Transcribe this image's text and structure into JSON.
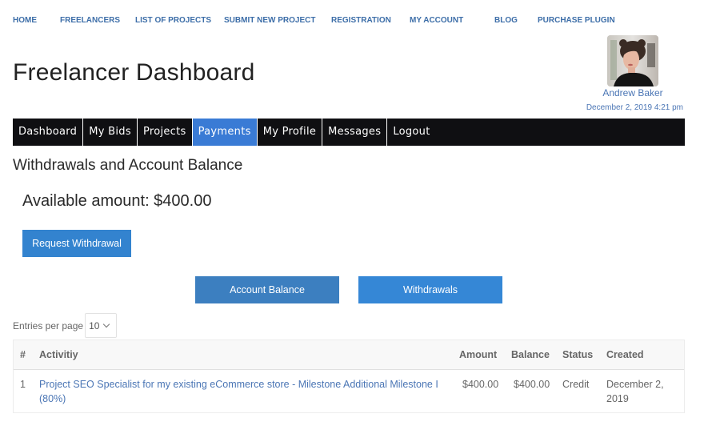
{
  "top_nav": [
    {
      "label": "HOME"
    },
    {
      "label": "FREELANCERS"
    },
    {
      "label": "LIST OF PROJECTS"
    },
    {
      "label": "SUBMIT NEW PROJECT"
    },
    {
      "label": "REGISTRATION"
    },
    {
      "label": "MY ACCOUNT"
    },
    {
      "label": "BLOG"
    },
    {
      "label": "PURCHASE PLUGIN"
    }
  ],
  "page_title": "Freelancer Dashboard",
  "user": {
    "name": "Andrew Baker",
    "datetime": "December 2, 2019 4:21 pm",
    "avatar_icon": "user-avatar-photo"
  },
  "tabs": [
    {
      "label": "Dashboard",
      "active": false
    },
    {
      "label": "My Bids",
      "active": false
    },
    {
      "label": "Projects",
      "active": false
    },
    {
      "label": "Payments",
      "active": true
    },
    {
      "label": "My Profile",
      "active": false
    },
    {
      "label": "Messages",
      "active": false
    },
    {
      "label": "Logout",
      "active": false
    }
  ],
  "section_title": "Withdrawals and Account Balance",
  "available_amount": "Available amount: $400.00",
  "buttons": {
    "request_withdrawal": "Request Withdrawal",
    "account_balance": "Account Balance",
    "withdrawals": "Withdrawals"
  },
  "entries": {
    "label": "Entries per page",
    "selected": "10",
    "chevron_icon": "chevron-down-icon"
  },
  "table": {
    "columns": [
      "#",
      "Activitiy",
      "Amount",
      "Balance",
      "Status",
      "Created"
    ],
    "rows": [
      {
        "num": "1",
        "activity_line1": "Project SEO Specialist for my existing eCommerce store - Milestone Additional Milestone I",
        "activity_line2": "(80%)",
        "amount": "$400.00",
        "balance": "$400.00",
        "status": "Credit",
        "created_line1": "December 2,",
        "created_line2": "2019"
      }
    ]
  },
  "colors": {
    "link": "#3d6ea8",
    "tab_bar": "#0f0f12",
    "tab_active": "#3a7bd5",
    "button": "#3383cf"
  }
}
